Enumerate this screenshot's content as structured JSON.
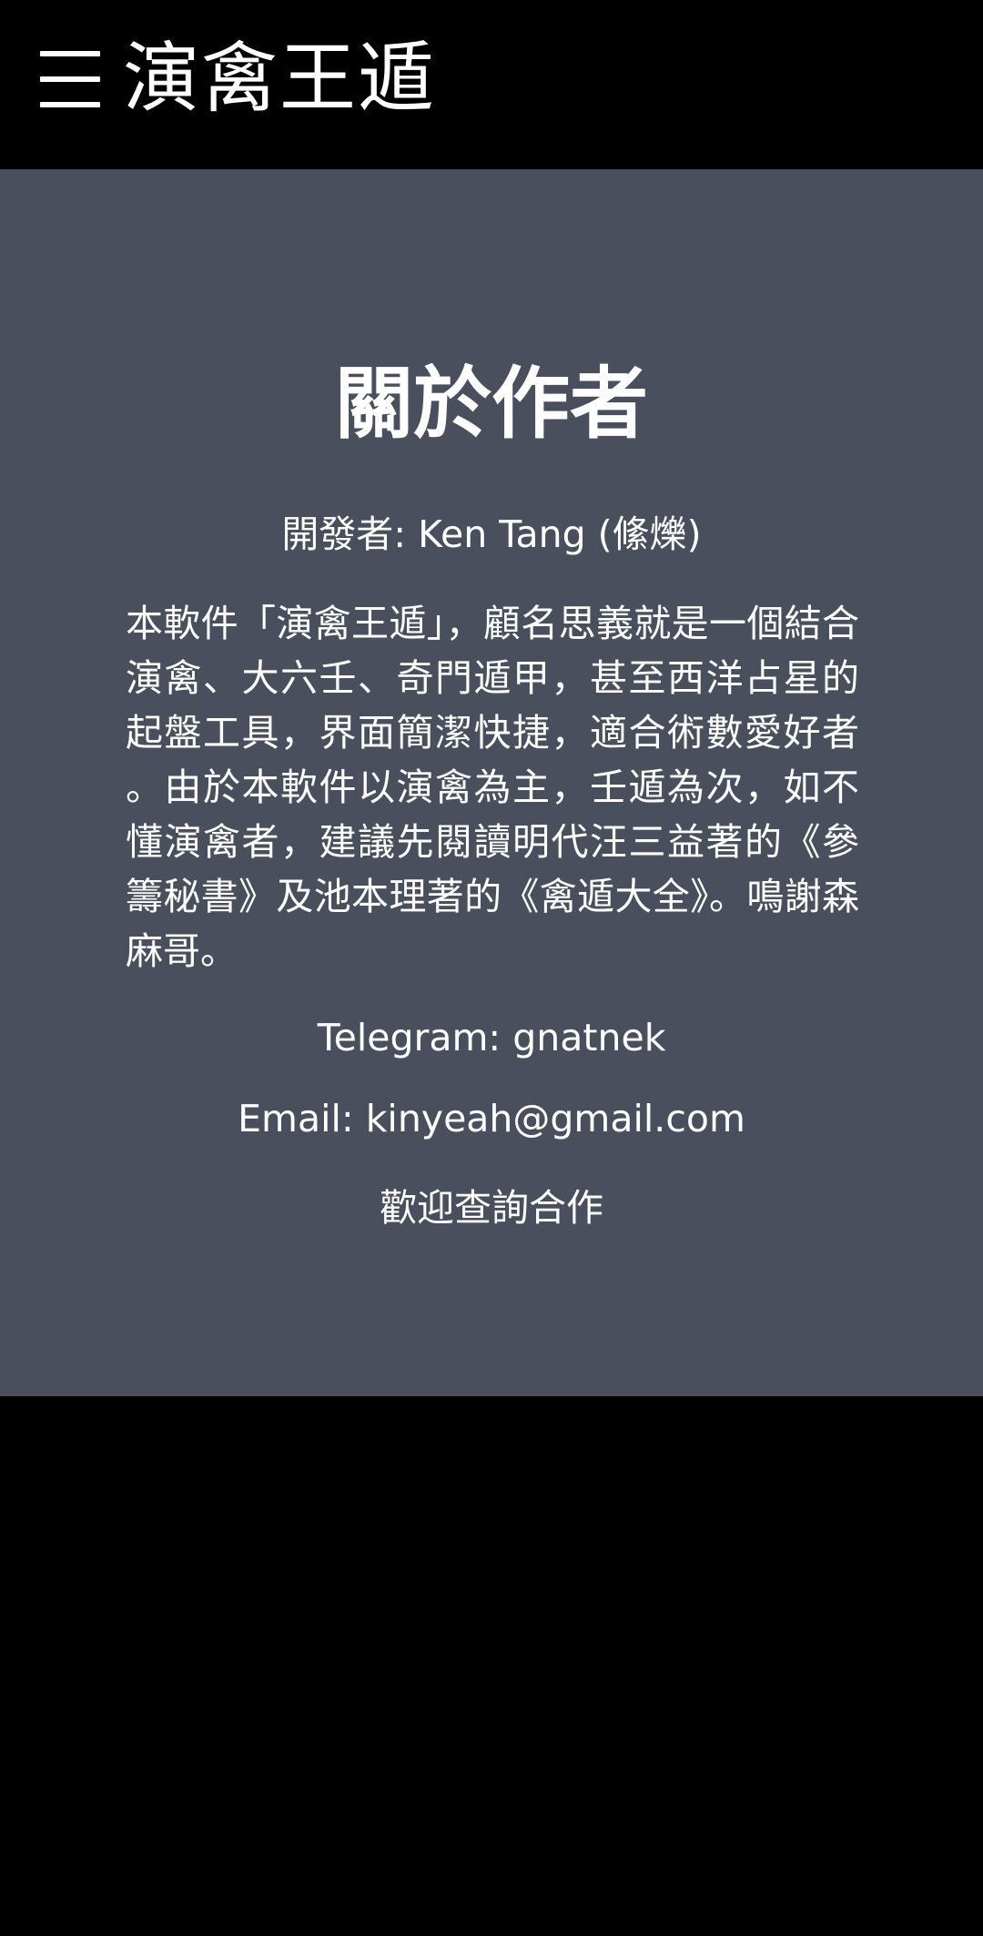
{
  "app_bar": {
    "menu_icon": "hamburger-menu-icon",
    "title": "演禽王遁"
  },
  "about": {
    "heading": "關於作者",
    "developer": "開發者: Ken Tang (絛爍)",
    "description": "本軟件「演禽王遁」，顧名思義就是一個結合演禽、大六壬、奇門遁甲，甚至西洋占星的起盤工具，界面簡潔快捷，適合術數愛好者。由於本軟件以演禽為主，壬遁為次，如不懂演禽者，建議先閱讀明代汪三益著的《參籌秘書》及池本理著的《禽遁大全》。鳴謝森麻哥。",
    "telegram": "Telegram: gnatnek",
    "email": "Email: kinyeah@gmail.com",
    "welcome": "歡迎查詢合作"
  },
  "colors": {
    "app_bar_bg": "#000000",
    "content_bg": "#4a4f5e",
    "text": "#ffffff"
  }
}
